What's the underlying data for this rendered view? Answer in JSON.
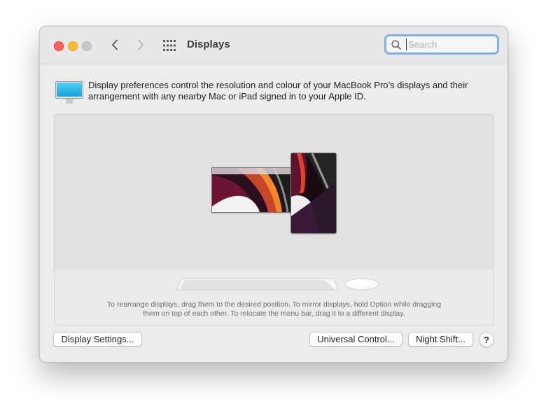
{
  "window": {
    "title": "Displays"
  },
  "search": {
    "placeholder": "Search",
    "value": ""
  },
  "description": "Display preferences control the resolution and colour of your MacBook Pro’s displays and their arrangement with any nearby Mac or iPad signed in to your Apple ID.",
  "arrangement": {
    "hint_line1": "To rearrange displays, drag them to the desired position. To mirror displays, hold Option while dragging",
    "hint_line2": "them on top of each other. To relocate the menu bar, drag it to a different display."
  },
  "buttons": {
    "display_settings": "Display Settings...",
    "universal_control": "Universal Control...",
    "night_shift": "Night Shift...",
    "help": "?"
  },
  "icons": {
    "close": "close-icon",
    "minimize": "minimize-icon",
    "zoom": "zoom-icon",
    "back": "chevron-left-icon",
    "forward": "chevron-right-icon",
    "show_all": "grid-icon",
    "search": "search-icon",
    "monitor": "monitor-icon",
    "keyboard": "keyboard-icon",
    "mouse": "mouse-icon"
  },
  "colors": {
    "close": "#ff5f57",
    "minimize": "#febc2e",
    "zoom": "#c8c8c8",
    "search_focus": "#7fb0ee",
    "monitor_screen": "#1fb3e6"
  }
}
